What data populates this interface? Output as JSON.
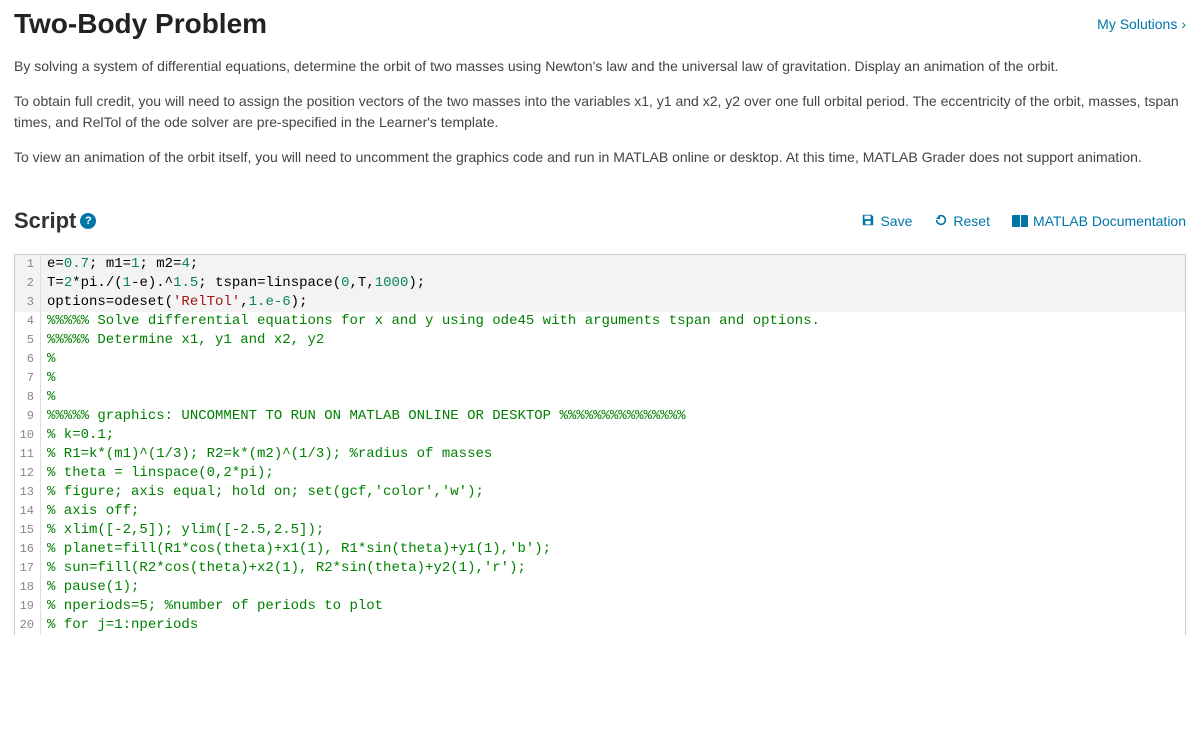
{
  "header": {
    "title": "Two-Body Problem",
    "my_solutions": "My Solutions"
  },
  "description": {
    "p1": "By solving a system of differential equations, determine the orbit of two masses using Newton's law and the universal law of gravitation.  Display an animation of the orbit.",
    "p2": "To obtain full credit, you will need to assign the position vectors of the two masses into the variables x1, y1 and x2, y2 over one full orbital period.  The eccentricity of the orbit, masses, tspan times, and RelTol of the ode solver are pre-specified in the Learner's template.",
    "p3": "To view an animation of the orbit itself, you will need to uncomment the graphics code and run  in MATLAB online or desktop.  At this time, MATLAB Grader does not support animation."
  },
  "script_header": {
    "title": "Script",
    "help": "?",
    "save": "Save",
    "reset": "Reset",
    "docs": "MATLAB Documentation"
  },
  "code_lines": [
    {
      "n": 1,
      "locked": true,
      "tokens": [
        [
          "id",
          "e="
        ],
        [
          "num",
          "0.7"
        ],
        [
          "id",
          "; m1="
        ],
        [
          "num",
          "1"
        ],
        [
          "id",
          "; m2="
        ],
        [
          "num",
          "4"
        ],
        [
          "id",
          ";"
        ]
      ]
    },
    {
      "n": 2,
      "locked": true,
      "tokens": [
        [
          "id",
          "T="
        ],
        [
          "num",
          "2"
        ],
        [
          "id",
          "*pi./("
        ],
        [
          "num",
          "1"
        ],
        [
          "id",
          "-e).^"
        ],
        [
          "num",
          "1.5"
        ],
        [
          "id",
          "; tspan=linspace("
        ],
        [
          "num",
          "0"
        ],
        [
          "id",
          ",T,"
        ],
        [
          "num",
          "1000"
        ],
        [
          "id",
          ");"
        ]
      ]
    },
    {
      "n": 3,
      "locked": true,
      "tokens": [
        [
          "id",
          "options=odeset("
        ],
        [
          "str",
          "'RelTol'"
        ],
        [
          "id",
          ","
        ],
        [
          "num",
          "1.e-6"
        ],
        [
          "id",
          ");"
        ]
      ]
    },
    {
      "n": 4,
      "locked": false,
      "tokens": [
        [
          "com",
          "%%%%% Solve differential equations for x and y using ode45 with arguments tspan and options."
        ]
      ]
    },
    {
      "n": 5,
      "locked": false,
      "tokens": [
        [
          "com",
          "%%%%% Determine x1, y1 and x2, y2"
        ]
      ]
    },
    {
      "n": 6,
      "locked": false,
      "tokens": [
        [
          "com",
          "%"
        ]
      ]
    },
    {
      "n": 7,
      "locked": false,
      "tokens": [
        [
          "com",
          "%"
        ]
      ]
    },
    {
      "n": 8,
      "locked": false,
      "tokens": [
        [
          "com",
          "%"
        ]
      ]
    },
    {
      "n": 9,
      "locked": false,
      "tokens": [
        [
          "com",
          "%%%%% graphics: UNCOMMENT TO RUN ON MATLAB ONLINE OR DESKTOP %%%%%%%%%%%%%%%"
        ]
      ]
    },
    {
      "n": 10,
      "locked": false,
      "tokens": [
        [
          "com",
          "% k=0.1;"
        ]
      ]
    },
    {
      "n": 11,
      "locked": false,
      "tokens": [
        [
          "com",
          "% R1=k*(m1)^(1/3); R2=k*(m2)^(1/3); %radius of masses"
        ]
      ]
    },
    {
      "n": 12,
      "locked": false,
      "tokens": [
        [
          "com",
          "% theta = linspace(0,2*pi);"
        ]
      ]
    },
    {
      "n": 13,
      "locked": false,
      "tokens": [
        [
          "com",
          "% figure; axis equal; hold on; set(gcf,'color','w');"
        ]
      ]
    },
    {
      "n": 14,
      "locked": false,
      "tokens": [
        [
          "com",
          "% axis off;"
        ]
      ]
    },
    {
      "n": 15,
      "locked": false,
      "tokens": [
        [
          "com",
          "% xlim([-2,5]); ylim([-2.5,2.5]);"
        ]
      ]
    },
    {
      "n": 16,
      "locked": false,
      "tokens": [
        [
          "com",
          "% planet=fill(R1*cos(theta)+x1(1), R1*sin(theta)+y1(1),'b');"
        ]
      ]
    },
    {
      "n": 17,
      "locked": false,
      "tokens": [
        [
          "com",
          "% sun=fill(R2*cos(theta)+x2(1), R2*sin(theta)+y2(1),'r');"
        ]
      ]
    },
    {
      "n": 18,
      "locked": false,
      "tokens": [
        [
          "com",
          "% pause(1);"
        ]
      ]
    },
    {
      "n": 19,
      "locked": false,
      "tokens": [
        [
          "com",
          "% nperiods=5; %number of periods to plot"
        ]
      ]
    },
    {
      "n": 20,
      "locked": false,
      "tokens": [
        [
          "com",
          "% for j=1:nperiods"
        ]
      ]
    }
  ]
}
